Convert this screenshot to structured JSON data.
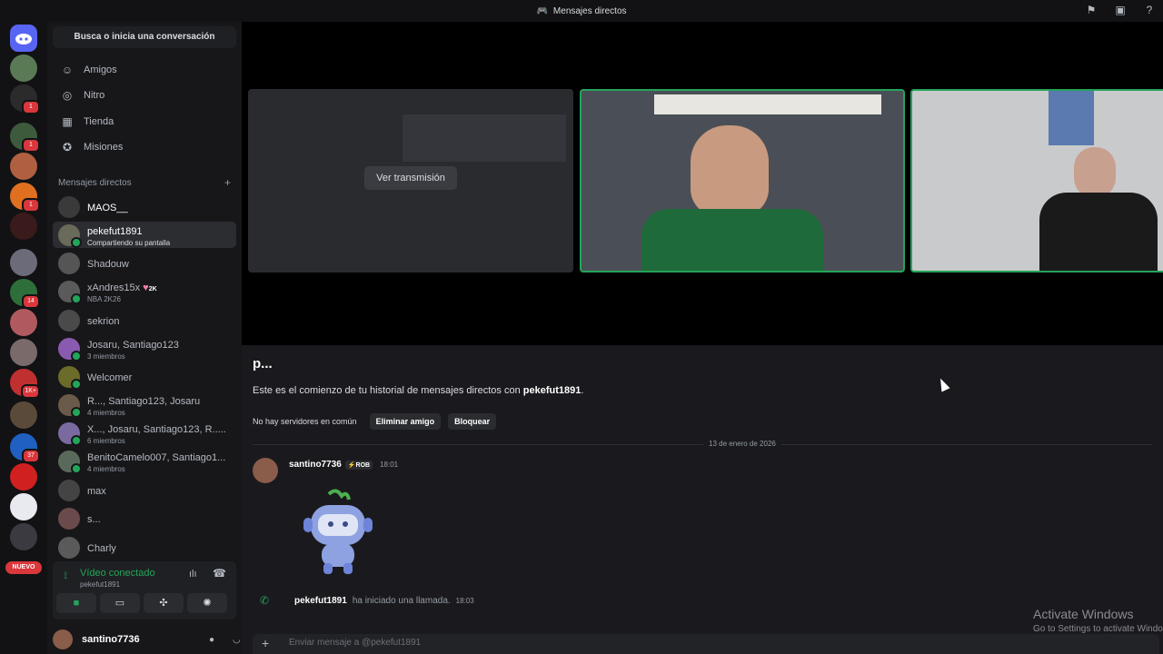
{
  "titlebar": {
    "title": "Mensajes directos"
  },
  "servers": {
    "badges": [
      "1",
      "1",
      "1",
      "14",
      "1K+",
      "37"
    ],
    "new_label": "NUEVO"
  },
  "sidebar": {
    "search_placeholder": "Busca o inicia una conversación",
    "nav": [
      {
        "label": "Amigos",
        "icon": "friends-icon"
      },
      {
        "label": "Nitro",
        "icon": "nitro-icon"
      },
      {
        "label": "Tienda",
        "icon": "shop-icon"
      },
      {
        "label": "Misiones",
        "icon": "quests-icon"
      }
    ],
    "dm_header": "Mensajes directos",
    "dms": [
      {
        "name": "MAOS__",
        "sub": ""
      },
      {
        "name": "pekefut1891",
        "sub": "Compartiendo su pantalla"
      },
      {
        "name": "Shadouw",
        "sub": ""
      },
      {
        "name": "xAndres15x",
        "sub": "NBA 2K26",
        "badge": "2K"
      },
      {
        "name": "sekrion",
        "sub": ""
      },
      {
        "name": "Josaru, Santiago123",
        "sub": "3 miembros"
      },
      {
        "name": "Welcomer",
        "sub": ""
      },
      {
        "name": "R..., Santiago123, Josaru",
        "sub": "4 miembros"
      },
      {
        "name": "X..., Josaru, Santiago123, R.....",
        "sub": "6 miembros"
      },
      {
        "name": "BenitoCamelo007, Santiago1...",
        "sub": "4 miembros"
      },
      {
        "name": "max",
        "sub": ""
      },
      {
        "name": "s...",
        "sub": ""
      },
      {
        "name": "Charly",
        "sub": ""
      }
    ]
  },
  "voice": {
    "status": "Vídeo conectado",
    "channel": "pekefut1891"
  },
  "user": {
    "name": "santino7736"
  },
  "stage": {
    "watch_stream": "Ver transmisión"
  },
  "chat": {
    "heading": "p...",
    "intro_prefix": "Este es el comienzo de tu historial de mensajes directos con ",
    "intro_user": "pekefut1891",
    "intro_suffix": ".",
    "no_servers": "No hay servidores en común",
    "remove_friend": "Eliminar amigo",
    "block": "Bloquear",
    "date": "13 de enero de 2026",
    "message": {
      "author": "santino7736",
      "tag": "ROB",
      "time": "18:01"
    },
    "call": {
      "user": "pekefut1891",
      "text": "ha iniciado una llamada.",
      "time": "18:03"
    },
    "composer_placeholder": "Enviar mensaje a @pekefut1891"
  },
  "watermark": {
    "line1": "Activate Windows",
    "line2": "Go to Settings to activate Windows."
  },
  "colors": {
    "green": "#23a55a",
    "red": "#da373c",
    "blurple": "#5865f2"
  }
}
